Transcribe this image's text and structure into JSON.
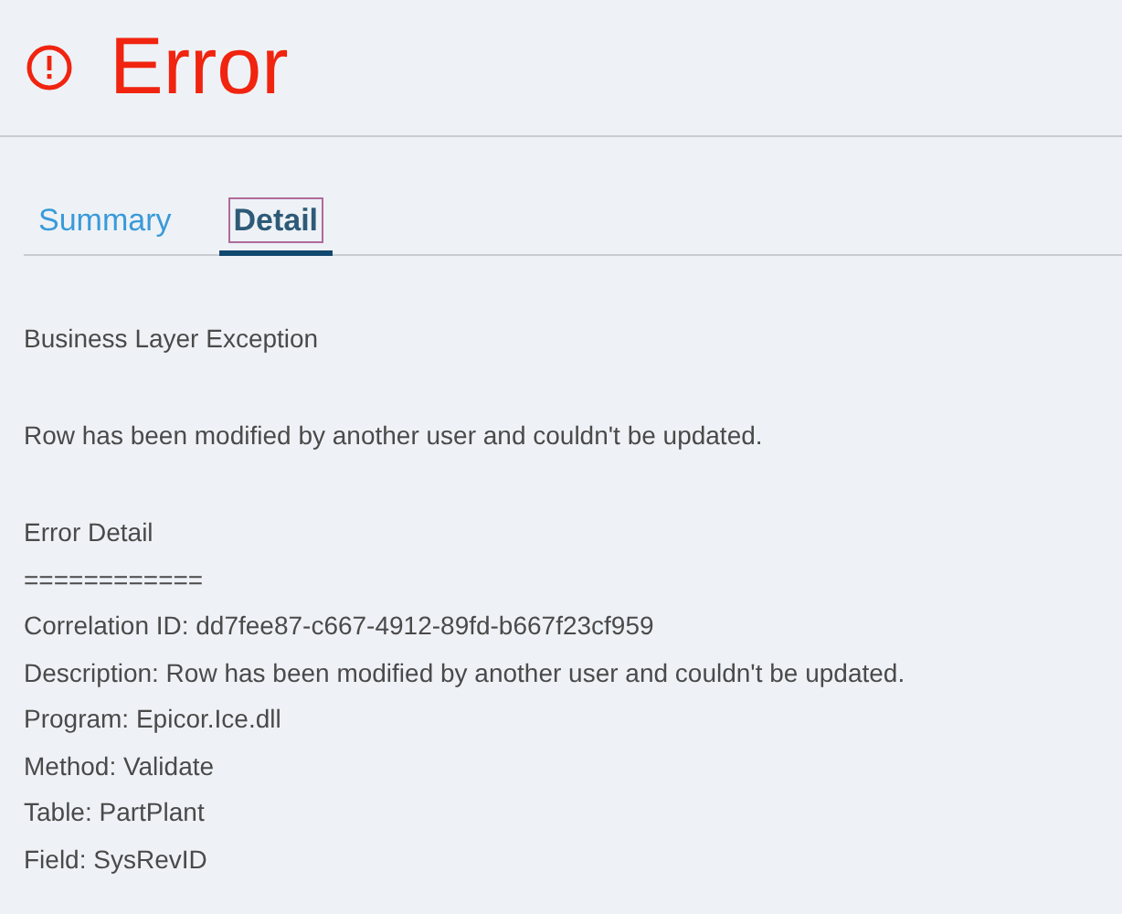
{
  "header": {
    "title": "Error"
  },
  "tabs": [
    {
      "label": "Summary",
      "selected": false
    },
    {
      "label": "Detail",
      "selected": true
    }
  ],
  "detail": {
    "paragraphs": [
      [
        "Business Layer Exception"
      ],
      [
        "Row has been modified by another user and couldn't be updated."
      ],
      [
        "Error Detail",
        "============",
        "Correlation ID: dd7fee87-c667-4912-89fd-b667f23cf959",
        "Description: Row has been modified by another user and couldn't be updated.",
        "Program: Epicor.Ice.dll",
        "Method: Validate",
        "Table: PartPlant",
        "Field: SysRevID"
      ]
    ]
  }
}
